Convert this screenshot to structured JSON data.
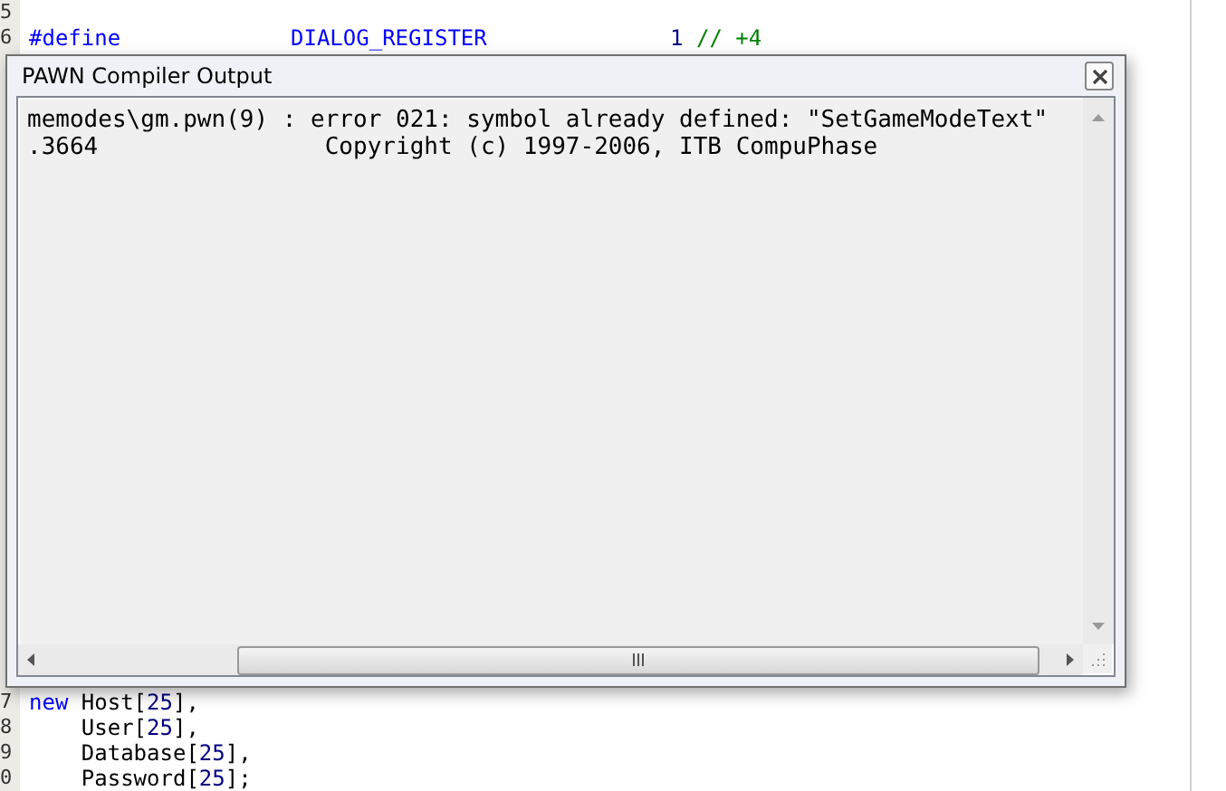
{
  "editor": {
    "top_lines": [
      {
        "number": "5"
      },
      {
        "number": "6",
        "tokens": [
          {
            "kind": "keyword",
            "text": "#define             "
          },
          {
            "kind": "keyword",
            "text": "DIALOG_REGISTER              "
          },
          {
            "kind": "number",
            "text": "1 "
          },
          {
            "kind": "comment",
            "text": "// +4"
          }
        ]
      }
    ],
    "bottom_lines": [
      {
        "number": "7",
        "tokens": [
          {
            "kind": "keyword",
            "text": "new "
          },
          {
            "kind": "plain",
            "text": "Host["
          },
          {
            "kind": "number",
            "text": "25"
          },
          {
            "kind": "plain",
            "text": "],"
          }
        ]
      },
      {
        "number": "8",
        "tokens": [
          {
            "kind": "plain",
            "text": "    User["
          },
          {
            "kind": "number",
            "text": "25"
          },
          {
            "kind": "plain",
            "text": "],"
          }
        ]
      },
      {
        "number": "9",
        "tokens": [
          {
            "kind": "plain",
            "text": "    Database["
          },
          {
            "kind": "number",
            "text": "25"
          },
          {
            "kind": "plain",
            "text": "],"
          }
        ]
      },
      {
        "number": "0",
        "tokens": [
          {
            "kind": "plain",
            "text": "    Password["
          },
          {
            "kind": "number",
            "text": "25"
          },
          {
            "kind": "plain",
            "text": "];"
          }
        ]
      }
    ]
  },
  "dialog": {
    "title": "PAWN Compiler Output",
    "output_lines": [
      "memodes\\gm.pwn(9) : error 021: symbol already defined: \"SetGameModeText\"",
      ".3664                Copyright (c) 1997-2006, ITB CompuPhase"
    ]
  }
}
